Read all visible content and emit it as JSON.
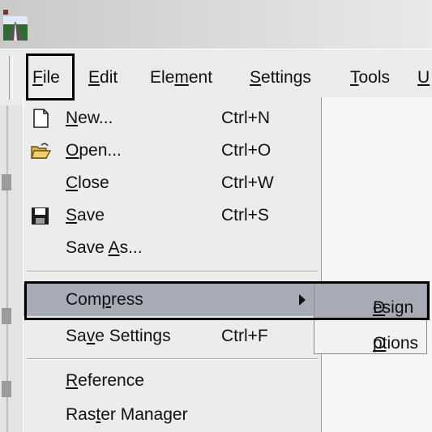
{
  "titlebar": {
    "icon": "app-logo-icon"
  },
  "menubar": {
    "items": [
      {
        "pre": "",
        "key": "F",
        "post": "ile"
      },
      {
        "pre": "",
        "key": "E",
        "post": "dit"
      },
      {
        "pre": "Ele",
        "key": "m",
        "post": "ent"
      },
      {
        "pre": "",
        "key": "S",
        "post": "ettings"
      },
      {
        "pre": "",
        "key": "T",
        "post": "ools"
      },
      {
        "pre": "",
        "key": "U",
        "post": ""
      }
    ]
  },
  "file_menu": {
    "items": [
      {
        "pre": "",
        "key": "N",
        "post": "ew...",
        "shortcut": "Ctrl+N",
        "icon": "new-document-icon"
      },
      {
        "pre": "",
        "key": "O",
        "post": "pen...",
        "shortcut": "Ctrl+O",
        "icon": "open-folder-icon"
      },
      {
        "pre": "",
        "key": "C",
        "post": "lose",
        "shortcut": "Ctrl+W",
        "icon": ""
      },
      {
        "pre": "",
        "key": "S",
        "post": "ave",
        "shortcut": "Ctrl+S",
        "icon": "save-disk-icon"
      },
      {
        "pre": "Save ",
        "key": "A",
        "post": "s...",
        "shortcut": "",
        "icon": ""
      },
      {
        "pre": "Com",
        "key": "p",
        "post": "ress",
        "shortcut": "",
        "icon": ""
      },
      {
        "pre": "Sa",
        "key": "v",
        "post": "e Settings",
        "shortcut": "Ctrl+F",
        "icon": ""
      },
      {
        "pre": "",
        "key": "R",
        "post": "eference",
        "shortcut": "",
        "icon": ""
      },
      {
        "pre": "Ras",
        "key": "t",
        "post": "er Manager",
        "shortcut": "",
        "icon": ""
      }
    ]
  },
  "compress_submenu": {
    "items": [
      {
        "pre": "",
        "key": "D",
        "post": "esign"
      },
      {
        "pre": "",
        "key": "O",
        "post": "ptions"
      }
    ]
  },
  "colors": {
    "highlight": "#a8abb6",
    "menu_bg": "#ececec",
    "annotation_box": "#000000"
  }
}
